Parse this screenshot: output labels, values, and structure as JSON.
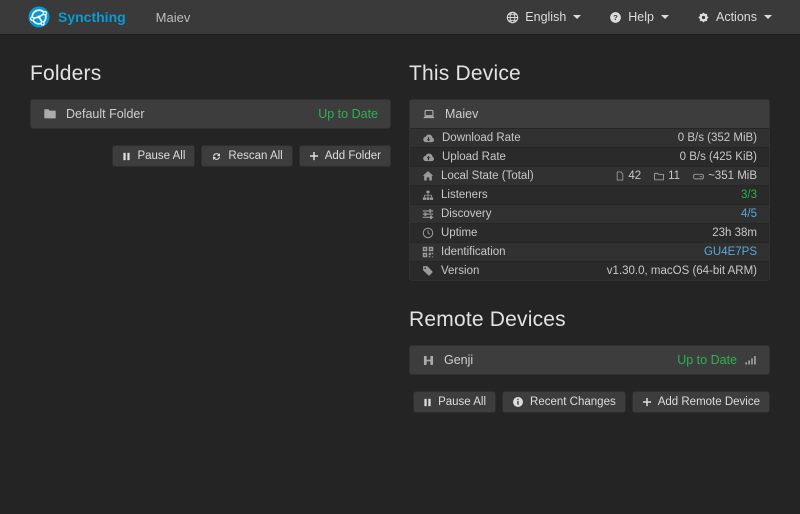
{
  "navbar": {
    "brand": "Syncthing",
    "device_name": "Maiev",
    "language_menu": "English",
    "help_menu": "Help",
    "actions_menu": "Actions"
  },
  "folders": {
    "heading": "Folders",
    "items": [
      {
        "name": "Default Folder",
        "status": "Up to Date"
      }
    ],
    "pause_all": "Pause All",
    "rescan_all": "Rescan All",
    "add_folder": "Add Folder"
  },
  "this_device": {
    "heading": "This Device",
    "name": "Maiev",
    "download_rate": {
      "label": "Download Rate",
      "value": "0 B/s (352 MiB)"
    },
    "upload_rate": {
      "label": "Upload Rate",
      "value": "0 B/s (425 KiB)"
    },
    "local_state": {
      "label": "Local State (Total)",
      "files": "42",
      "directories": "11",
      "size": "~351 MiB"
    },
    "listeners": {
      "label": "Listeners",
      "value": "3/3"
    },
    "discovery": {
      "label": "Discovery",
      "value": "4/5"
    },
    "uptime": {
      "label": "Uptime",
      "value": "23h 38m"
    },
    "identification": {
      "label": "Identification",
      "value": "GU4E7PS"
    },
    "version": {
      "label": "Version",
      "value": "v1.30.0, macOS (64-bit ARM)"
    }
  },
  "remote_devices": {
    "heading": "Remote Devices",
    "devices": [
      {
        "name": "Genji",
        "status": "Up to Date"
      }
    ],
    "pause_all": "Pause All",
    "recent_changes": "Recent Changes",
    "add_remote_device": "Add Remote Device"
  },
  "colors": {
    "brand_blue": "#0a9bd5",
    "link_blue": "#57a8db",
    "success_green": "#2eb150"
  }
}
